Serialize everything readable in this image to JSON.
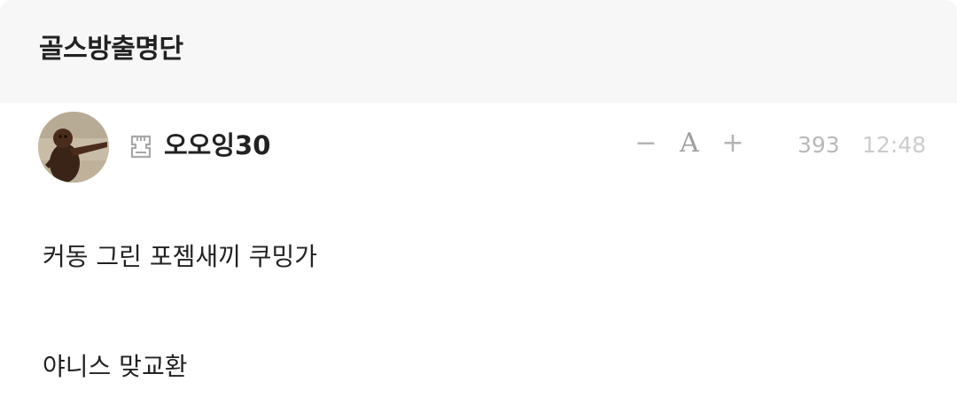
{
  "board": {
    "title": "골스방출명단"
  },
  "post": {
    "author": "오오잉30",
    "avatar_icon": "avatar-photo",
    "level_icon": "level-badge-icon",
    "font_controls": {
      "decrease": "−",
      "label": "A",
      "increase": "+"
    },
    "views": "393",
    "time": "12:48",
    "body": [
      "커동 그린 포젬새끼 쿠밍가",
      "야니스 맞교환"
    ]
  },
  "colors": {
    "header_bg": "#f7f7f7",
    "text": "#222222",
    "muted": "#b3b3b3"
  }
}
